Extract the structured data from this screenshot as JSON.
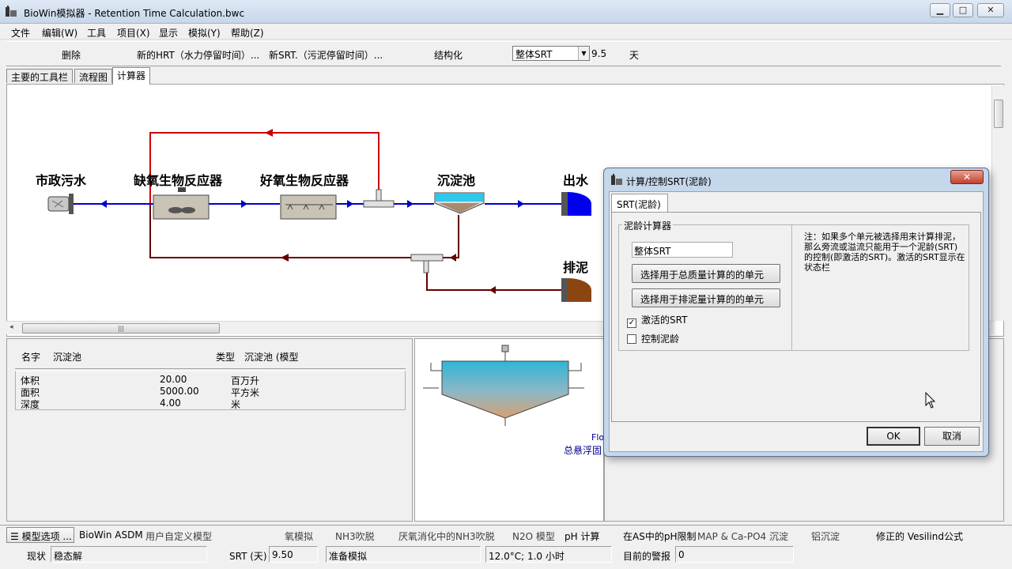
{
  "window": {
    "title": "BioWin模拟器 - Retention Time Calculation.bwc",
    "controls": {
      "minimize": "▁",
      "maximize": "□",
      "close": "✕"
    }
  },
  "menu": [
    "文件",
    "编辑(W)",
    "工具",
    "项目(X)",
    "显示",
    "模拟(Y)",
    "帮助(Z)"
  ],
  "toolbar": {
    "delete": "删除",
    "new_hrt": "新的HRT（水力停留时间）...",
    "new_srt": "新SRT.（污泥停留时间）...",
    "structure": "结构化",
    "srt_mode": "整体SRT",
    "srt_value": "9.5",
    "srt_unit": "天"
  },
  "tabs": [
    "主要的工具栏",
    "流程图",
    "计算器"
  ],
  "active_tab": "计算器",
  "flowsheet": {
    "units": {
      "influent": "市政污水",
      "anoxic": "缺氧生物反应器",
      "aerobic": "好氧生物反应器",
      "clarifier": "沉淀池",
      "effluent": "出水",
      "waste": "排泥"
    },
    "colors": {
      "flow": "#0000cc",
      "recycle": "#cc0000",
      "return": "#660000",
      "effluent_cap": "#0000ee",
      "waste_cap": "#8b4513"
    }
  },
  "properties": {
    "name_label": "名字",
    "name_value": "沉淀池",
    "type_label": "类型",
    "type_value": "沉淀池 (模型",
    "rows": [
      {
        "label": "体积",
        "value": "20.00",
        "unit": "百万升"
      },
      {
        "label": "面积",
        "value": "5000.00",
        "unit": "平方米"
      },
      {
        "label": "深度",
        "value": "4.00",
        "unit": "米"
      }
    ]
  },
  "preview": {
    "line1": "Flo",
    "line2": "总悬浮固"
  },
  "model_bar": {
    "options_button": "模型选项 ...",
    "items": [
      "BioWin ASDM",
      "用户自定义模型",
      "氧模拟",
      "NH3吹脱",
      "厌氧消化中的NH3吹脱",
      "N2O 模型",
      "pH 计算",
      "在AS中的pH限制",
      "MAP & Ca-PO4 沉淀",
      "铝沉淀",
      "修正的 Vesilind公式"
    ]
  },
  "status": {
    "state_label": "现状",
    "state_value": "稳态解",
    "srt_label": "SRT (天)",
    "srt_value": "9.50",
    "sim_value": "准备模拟",
    "temp_value": "12.0°C; 1.0 小时",
    "alarm_label": "目前的警报",
    "alarm_value": "0"
  },
  "dialog": {
    "title": "计算/控制SRT(泥龄)",
    "close": "✕",
    "tab": "SRT(泥龄)",
    "group_title": "泥龄计算器",
    "name_input": "整体SRT",
    "btn_mass": "选择用于总质量计算的的单元",
    "btn_waste": "选择用于排泥量计算的的单元",
    "chk_active": "激活的SRT",
    "chk_active_checked": true,
    "chk_control": "控制泥龄",
    "chk_control_checked": false,
    "note": "注：如果多个单元被选择用来计算排泥，那么旁流或溢流只能用于一个泥龄(SRT)的控制(即激活的SRT)。激活的SRT显示在状态栏",
    "ok": "OK",
    "cancel": "取消"
  }
}
